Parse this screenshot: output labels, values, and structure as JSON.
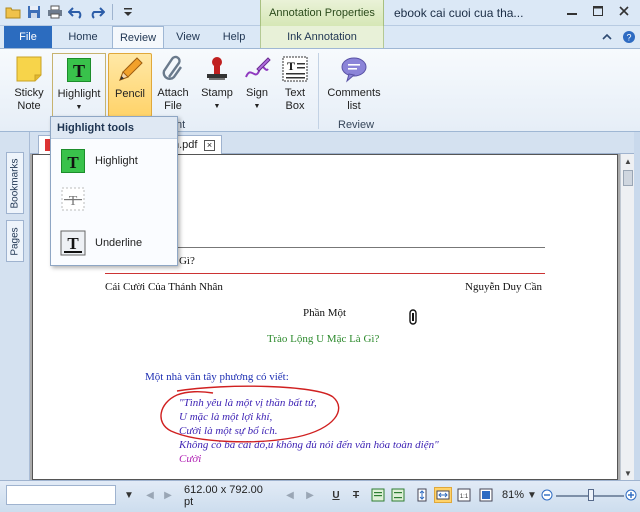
{
  "window": {
    "title": "ebook cai cuoi cua tha...",
    "contextual_group": "Annotation Properties"
  },
  "quick_access": {
    "icons": [
      "folder-open-icon",
      "save-icon",
      "print-icon",
      "undo-icon",
      "redo-icon",
      "customize-icon"
    ]
  },
  "tabs": {
    "file": "File",
    "items": [
      "Home",
      "Review",
      "View",
      "Help"
    ],
    "contextual": "Ink Annotation",
    "active": "Review"
  },
  "ribbon": {
    "buttons": {
      "sticky_note": "Sticky\nNote",
      "highlight": "Highlight",
      "pencil": "Pencil",
      "attach_file": "Attach\nFile",
      "stamp": "Stamp",
      "sign": "Sign",
      "text_box": "Text\nBox",
      "comments_list": "Comments\nlist"
    },
    "group_labels": {
      "annotations_tail": "nt",
      "review": "Review"
    }
  },
  "highlight_menu": {
    "header": "Highlight tools",
    "items": [
      "Highlight",
      "",
      "Underline"
    ]
  },
  "left_panel": {
    "tabs": [
      "Bookmarks",
      "Pages"
    ]
  },
  "document": {
    "tab_label": "n.pdf",
    "lines": {
      "partial_title": "c Là Gì?",
      "header_left": "Cái Cười Của Thánh Nhân",
      "header_right": "Nguyễn Duy Cần",
      "part": "Phần Một",
      "chapter": "Trào Lộng U Mặc Là Gì?",
      "intro": "Một nhà văn tây phương có viết:",
      "quote1": "\"Tình yêu là một vị thần bất tử,",
      "quote2": "U mặc là một lợi khí,",
      "quote3": "Cười là một sự bổ ích.",
      "quote4": "Không có ba cái đó,u không đủ nói  đến văn hóa toàn diện\"",
      "quote5": "Cười"
    },
    "colors": {
      "chapter": "#2e8b2e",
      "intro": "#1e2fb3",
      "quote": "#3a1fb3",
      "ink": "#d02020"
    }
  },
  "status_bar": {
    "page_size": "612.00 x 792.00 pt",
    "zoom": "81%"
  }
}
